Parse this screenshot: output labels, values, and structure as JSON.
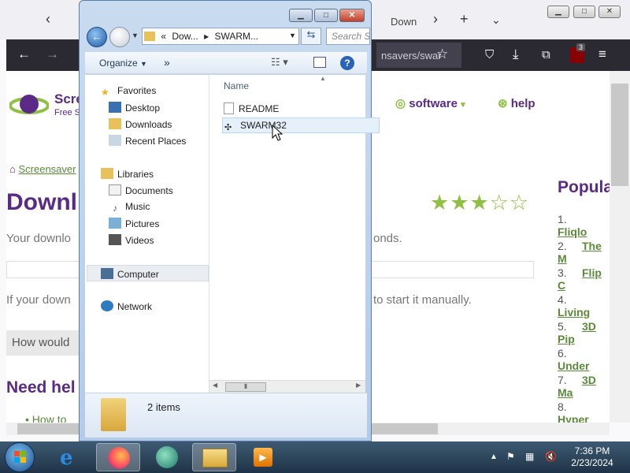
{
  "browser": {
    "tab_title": "Down",
    "url": "nsavers/swar",
    "badge_count": "3"
  },
  "site": {
    "brand": "Scre",
    "brand_sub": "Free S",
    "menu_software": "software",
    "menu_help": "help",
    "breadcrumb": "Screensaver",
    "heading": "Downl",
    "rating": 3,
    "rating_max": 5,
    "text_download": "Your downlo",
    "text_seconds": "onds.",
    "text_if": "If your down",
    "text_manual": "to start it manually.",
    "how": "How would",
    "need_help": "Need hel",
    "bullet": "How to",
    "popular_title": "Popula",
    "popular": [
      {
        "num": "1.",
        "label": "Fliqlo"
      },
      {
        "num": "2.",
        "label": "The M"
      },
      {
        "num": "3.",
        "label": "Flip C"
      },
      {
        "num": "4.",
        "label": "Living"
      },
      {
        "num": "5.",
        "label": "3D Pip"
      },
      {
        "num": "6.",
        "label": "Under"
      },
      {
        "num": "7.",
        "label": "3D Ma"
      },
      {
        "num": "8.",
        "label": "Hyper"
      }
    ]
  },
  "explorer": {
    "address_prefix": "«",
    "address_part1": "Dow...",
    "address_part2": "SWARM...",
    "search_placeholder": "Search S",
    "organize": "Organize",
    "more": "»",
    "nav": {
      "favorites": "Favorites",
      "desktop": "Desktop",
      "downloads": "Downloads",
      "recent": "Recent Places",
      "libraries": "Libraries",
      "documents": "Documents",
      "music": "Music",
      "pictures": "Pictures",
      "videos": "Videos",
      "computer": "Computer",
      "network": "Network"
    },
    "column_name": "Name",
    "files": [
      {
        "name": "README"
      },
      {
        "name": "SWARM32"
      }
    ],
    "item_count": "2 items"
  },
  "taskbar": {
    "time": "7:36 PM",
    "date": "2/23/2024"
  }
}
